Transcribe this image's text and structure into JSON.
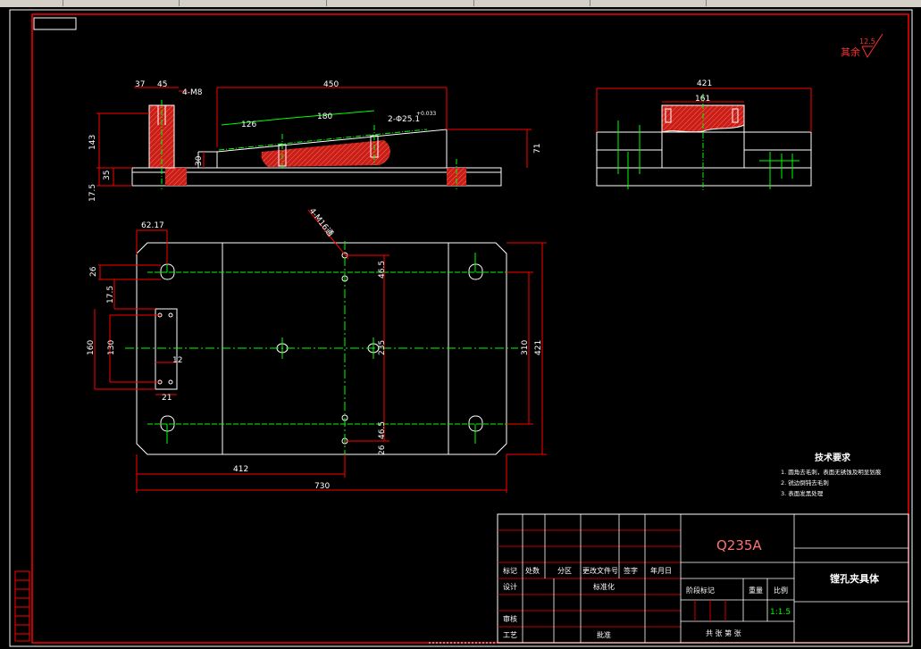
{
  "drawing": {
    "roughness_symbol": {
      "prefix": "其余",
      "value": "12.5"
    },
    "technical_requirements": {
      "title": "技术要求",
      "items": [
        "1. 圆角去毛刺，表面无锈蚀及明显划痕",
        "2. 锐边倒钝去毛刺",
        "3. 表面发黑处理"
      ]
    },
    "title_block": {
      "material": "Q235A",
      "part_name": "镗孔夹具体",
      "scale": "1:1.5",
      "header_labels": [
        "标记",
        "处数",
        "分区",
        "更改文件号",
        "签字",
        "年月日"
      ],
      "row_labels": [
        "设计",
        "审核",
        "工艺"
      ],
      "extra_labels": [
        "标准化",
        "批准",
        "阶段标记",
        "重量",
        "比例",
        "共 张 第 张"
      ]
    }
  },
  "dimensions": {
    "front": {
      "d37": "37",
      "d45": "45",
      "m8": "4-M8",
      "d450": "450",
      "d126": "126",
      "d180": "180",
      "hole": "2-Φ25.1",
      "tol": "+0.033",
      "d143": "143",
      "d35": "35",
      "d175": "17.5",
      "d30": "30",
      "d71": "71"
    },
    "side": {
      "d421": "421",
      "d161": "161"
    },
    "plan": {
      "d6217": "62.17",
      "thread": "4-M16通",
      "d26a": "26",
      "d175": "17.5",
      "d160": "160",
      "d130": "130",
      "d12": "12",
      "d21": "21",
      "d465a": "46.5",
      "d235": "235",
      "d310": "310",
      "d421": "421",
      "d465b": "46.5",
      "d26b": "26",
      "d412": "412",
      "d730": "730"
    }
  },
  "colors": {
    "background": "#000000",
    "outline": "#ffffff",
    "frame": "#ff0000",
    "center": "#00ff00",
    "hatch": "#e8261e",
    "dim_line": "#ff0000"
  }
}
